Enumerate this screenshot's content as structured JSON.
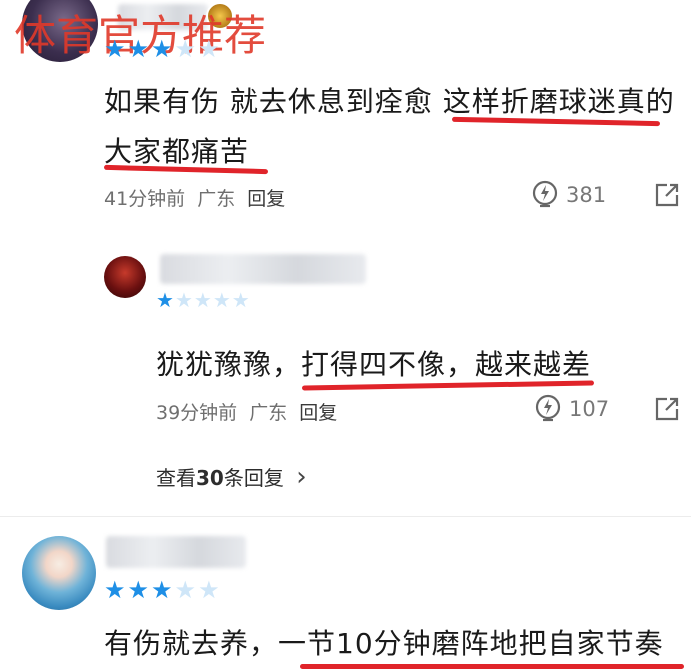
{
  "watermark": "体育官方推荐",
  "comments": [
    {
      "stars": [
        true,
        true,
        true,
        false,
        false
      ],
      "text_line1": "如果有伤 就去休息到痊愈 这样折磨球迷真的",
      "text_line2": "大家都痛苦",
      "time": "41分钟前",
      "location": "广东",
      "reply_label": "回复",
      "likes": "381"
    },
    {
      "stars": [
        true,
        false,
        false,
        false,
        false
      ],
      "text": "犹犹豫豫，打得四不像，越来越差",
      "time": "39分钟前",
      "location": "广东",
      "reply_label": "回复",
      "likes": "107"
    },
    {
      "stars": [
        true,
        true,
        true,
        false,
        false
      ],
      "text": "有伤就去养，一节10分钟磨阵地把自家节奏"
    }
  ],
  "view_replies": {
    "prefix": "查看",
    "count": "30",
    "suffix": "条回复",
    "chevron": "›"
  },
  "colors": {
    "star_on": "#1e8fe6",
    "star_off": "#cfe6f8",
    "underline": "#e0242a",
    "watermark": "#e0392a"
  },
  "icons": [
    "like-icon",
    "share-icon",
    "chevron-right-icon"
  ]
}
